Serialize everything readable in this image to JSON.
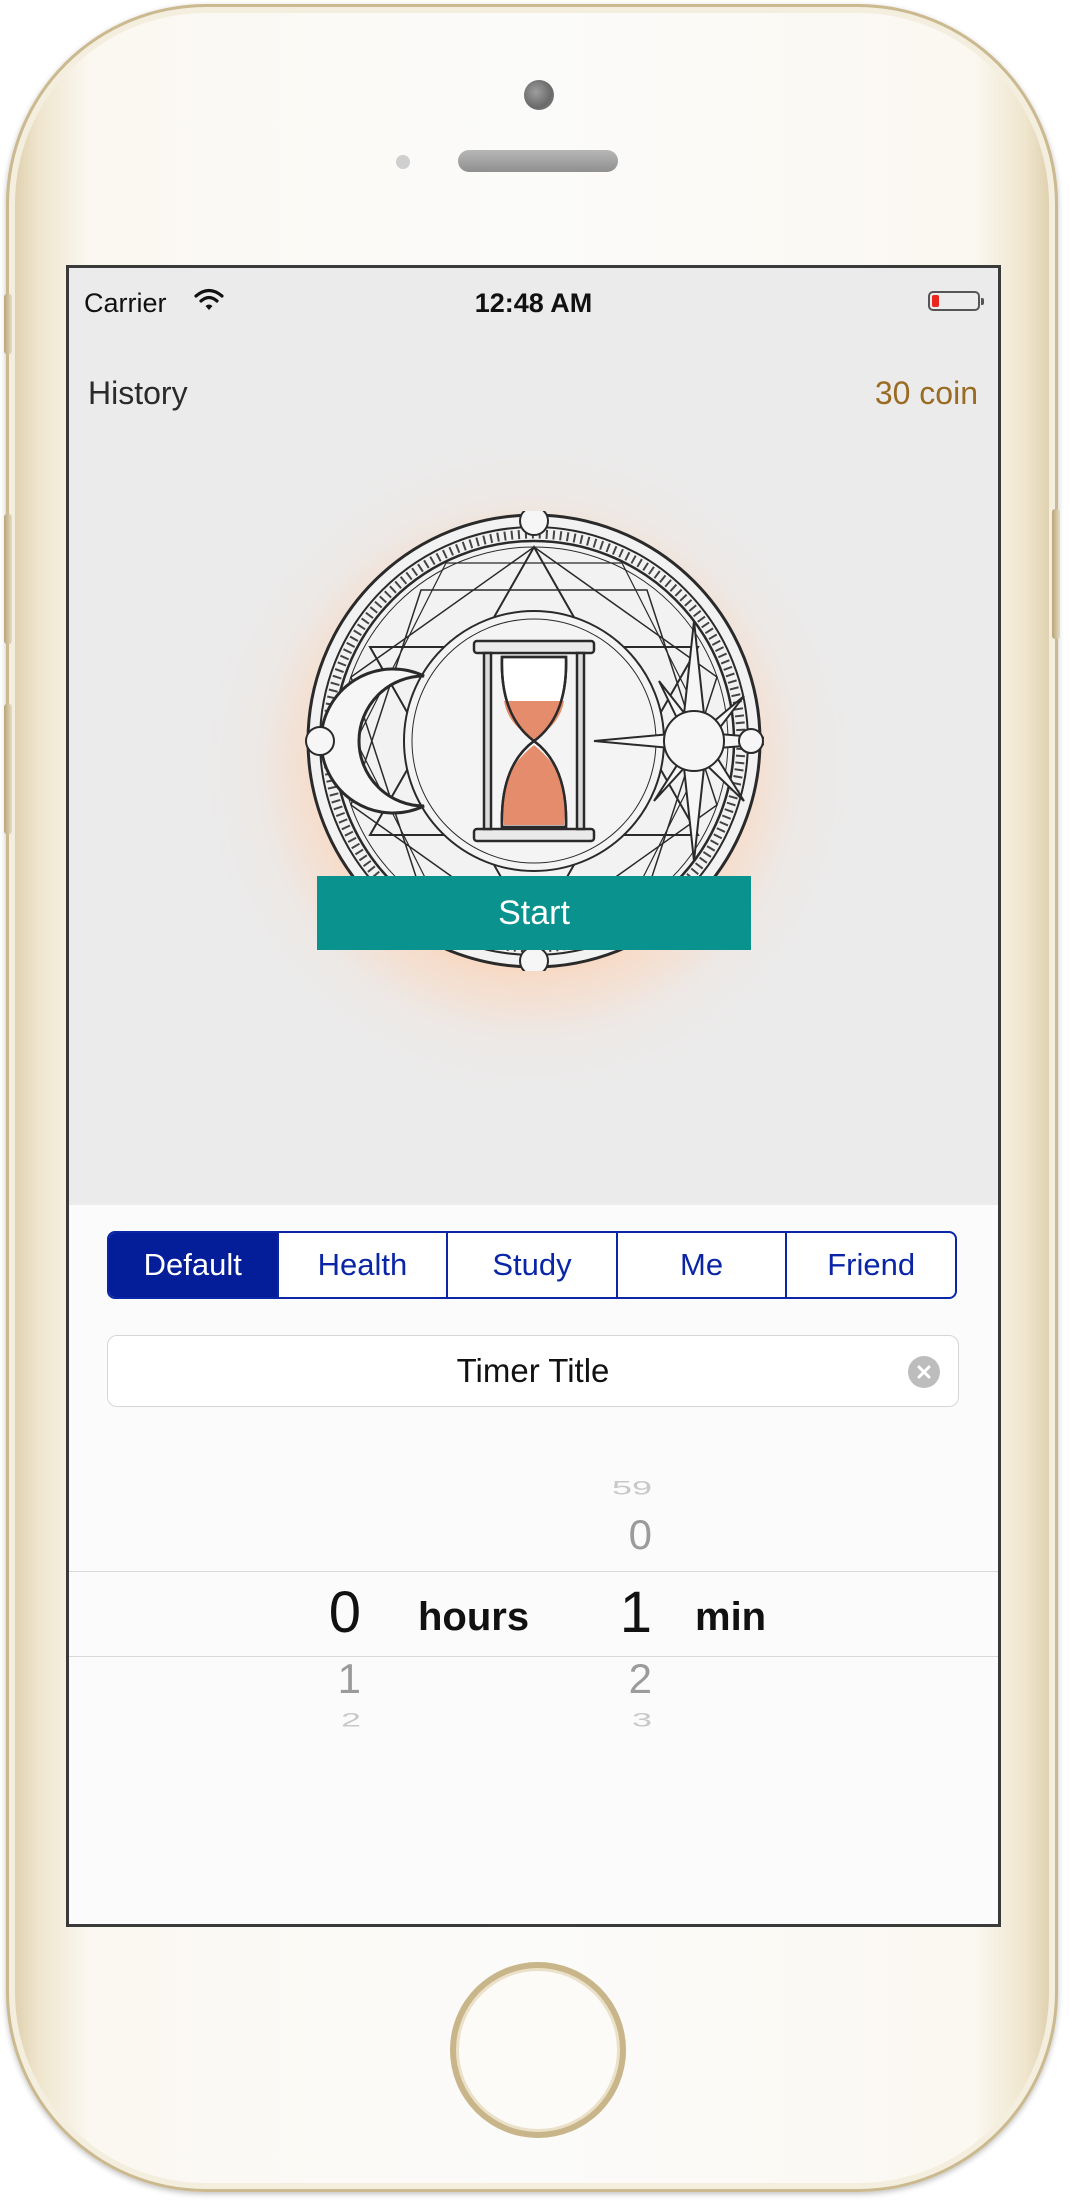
{
  "status_bar": {
    "carrier": "Carrier",
    "time": "12:48 AM",
    "battery_level": 0.15,
    "battery_color": "#e8261e"
  },
  "nav": {
    "history_label": "History",
    "coin_label": "30 coin",
    "coin_color": "#9a6b23"
  },
  "emblem": {
    "icon": "hourglass-emblem-icon",
    "sand_color": "#e58c6c"
  },
  "categories": {
    "items": [
      "Default",
      "Health",
      "Study",
      "Me",
      "Friend"
    ],
    "selected": "Default",
    "accent": "#031e98"
  },
  "timer_title": {
    "value": "Timer Title",
    "clear_icon": "clear-icon"
  },
  "picker": {
    "hours": {
      "above": [
        "",
        ""
      ],
      "selected": "0",
      "below": [
        "1",
        "2"
      ],
      "unit": "hours"
    },
    "minutes": {
      "above": [
        "59",
        "0"
      ],
      "selected": "1",
      "below": [
        "2",
        "3"
      ],
      "unit": "min"
    }
  },
  "start_button": {
    "label": "Start",
    "color": "#0a928f"
  }
}
